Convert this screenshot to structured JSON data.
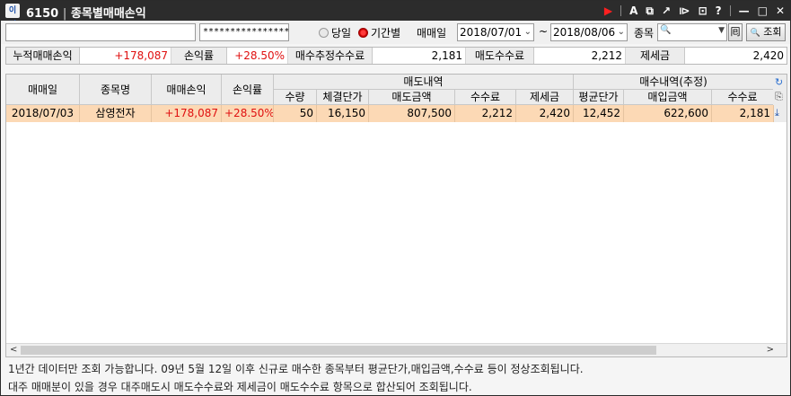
{
  "window": {
    "app_icon": "이전",
    "screen_no": "6150",
    "title": "종목별매매손익",
    "toolbar_icons": [
      "play-icon",
      "font-icon",
      "capture-icon",
      "pin-icon",
      "link-icon",
      "window-icon",
      "help-icon",
      "minimize-icon",
      "maximize-icon",
      "close-icon"
    ],
    "icon_glyphs": {
      "play": "▶",
      "font": "A",
      "capture": "⧉",
      "pin": "↗",
      "link": "⧐",
      "window": "⊡",
      "help": "?",
      "minimize": "—",
      "maximize": "□",
      "close": "✕"
    }
  },
  "toolbar": {
    "account_value": "",
    "password_value": "****************",
    "radio_today": "당일",
    "radio_period": "기간별",
    "radio_selected": "기간별",
    "trade_date_label": "매매일",
    "date_from": "2018/07/01",
    "date_sep": "~",
    "date_to": "2018/08/06",
    "stock_label": "종목",
    "search_glyph": "🔍",
    "query_button": "조회",
    "calc_button": "囘"
  },
  "summary": {
    "cum_pl_label": "누적매매손익",
    "cum_pl_value": "+178,087",
    "pl_rate_label": "손익률",
    "pl_rate_value": "+28.50%",
    "buy_fee_label": "매수추정수수료",
    "buy_fee_value": "2,181",
    "sell_fee_label": "매도수수료",
    "sell_fee_value": "2,212",
    "tax_label": "제세금",
    "tax_value": "2,420"
  },
  "grid": {
    "headers": {
      "trade_date": "매매일",
      "stock_name": "종목명",
      "trade_pl": "매매손익",
      "pl_rate": "손익률",
      "sell_group": "매도내역",
      "buy_group": "매수내역(추정)",
      "qty": "수량",
      "exec_price": "체결단가",
      "sell_amount": "매도금액",
      "sell_fee": "수수료",
      "tax": "제세금",
      "avg_price": "평균단가",
      "buy_amount": "매입금액",
      "buy_fee": "수수료"
    },
    "rows": [
      {
        "trade_date": "2018/07/03",
        "stock_name": "삼영전자",
        "trade_pl": "+178,087",
        "pl_rate": "+28.50%",
        "qty": "50",
        "exec_price": "16,150",
        "sell_amount": "807,500",
        "sell_fee": "2,212",
        "tax": "2,420",
        "avg_price": "12,452",
        "buy_amount": "622,600",
        "buy_fee": "2,181"
      }
    ]
  },
  "notes": {
    "line1": "1년간 데이터만 조회 가능합니다. 09년 5월 12일 이후 신규로 매수한 종목부터 평균단가,매입금액,수수료 등이 정상조회됩니다.",
    "line2": "대주 매매분이 있을 경우 대주매도시 매도수수료와 제세금이 매도수수료 항목으로 합산되어 조회됩니다."
  },
  "colors": {
    "positive": "#e01010",
    "row_highlight": "#fcd9b5",
    "titlebar": "#2c2c2c"
  }
}
